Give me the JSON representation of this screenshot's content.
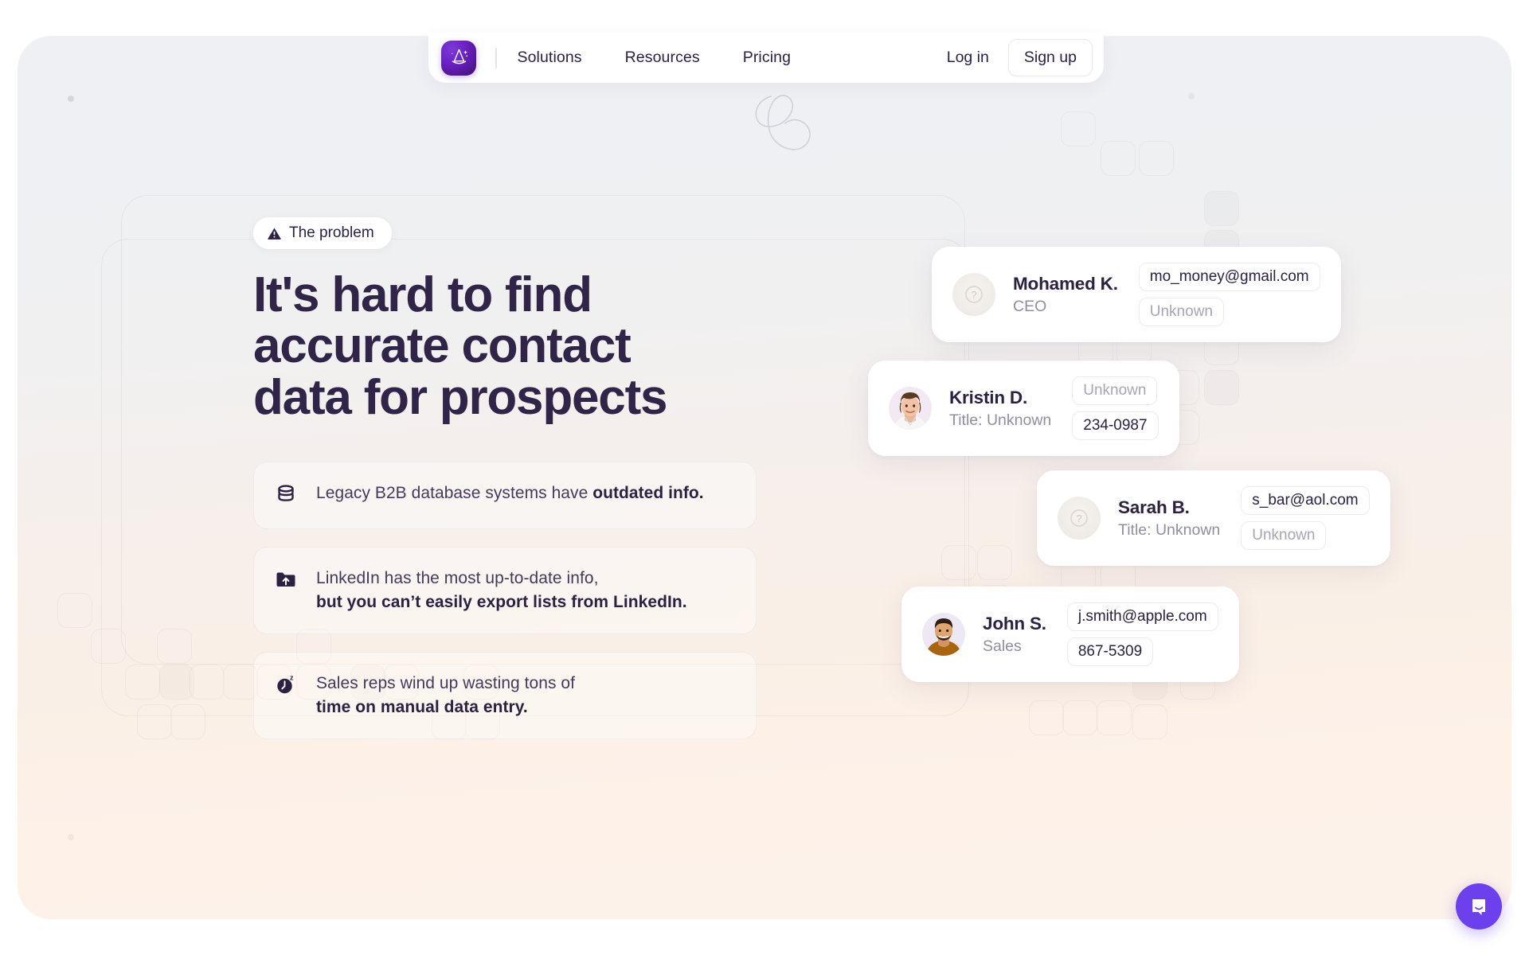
{
  "brand": {
    "logo_icon": "wizard-hat-icon",
    "logo_color": "#6b21c4"
  },
  "nav": {
    "links": [
      {
        "label": "Solutions"
      },
      {
        "label": "Resources"
      },
      {
        "label": "Pricing"
      }
    ],
    "login_label": "Log in",
    "signup_label": "Sign up"
  },
  "hero": {
    "badge": {
      "icon": "warning-triangle-icon",
      "label": "The problem"
    },
    "headline_line1": "It's hard to find",
    "headline_line2": "accurate contact",
    "headline_line3": "data for prospects"
  },
  "problems": [
    {
      "icon": "database-icon",
      "line1_plain": "Legacy B2B database systems have ",
      "line1_bold": "outdated info.",
      "line2_plain": "",
      "line2_bold": ""
    },
    {
      "icon": "folder-upload-icon",
      "line1_plain": "LinkedIn has the most up-to-date info,",
      "line1_bold": "",
      "line2_plain": "",
      "line2_bold": "but you can’t easily export lists from LinkedIn."
    },
    {
      "icon": "clock-sleep-icon",
      "line1_plain": "Sales reps wind up wasting tons of",
      "line1_bold": "",
      "line2_plain": "",
      "line2_bold": "time on manual data entry."
    }
  ],
  "contacts": [
    {
      "name": "Mohamed K.",
      "title": "CEO",
      "avatar": "unknown-avatar",
      "fields": [
        {
          "value": "mo_money@gmail.com",
          "unknown": false
        },
        {
          "value": "Unknown",
          "unknown": true
        }
      ]
    },
    {
      "name": "Kristin D.",
      "title": "Title: Unknown",
      "avatar": "photo-woman",
      "fields": [
        {
          "value": "Unknown",
          "unknown": true
        },
        {
          "value": "234-0987",
          "unknown": false
        }
      ]
    },
    {
      "name": "Sarah B.",
      "title": "Title: Unknown",
      "avatar": "unknown-avatar",
      "fields": [
        {
          "value": "s_bar@aol.com",
          "unknown": false
        },
        {
          "value": "Unknown",
          "unknown": true
        }
      ]
    },
    {
      "name": "John S.",
      "title": "Sales",
      "avatar": "photo-man",
      "fields": [
        {
          "value": "j.smith@apple.com",
          "unknown": false
        },
        {
          "value": "867-5309",
          "unknown": false
        }
      ]
    }
  ],
  "chat": {
    "icon": "chat-bubble-smile-icon",
    "color": "#6c40ec"
  },
  "colors": {
    "text_primary": "#2d2142",
    "text_muted": "#928da0",
    "bg_top": "#eef0f4",
    "bg_bottom": "#fdf2ea",
    "accent": "#6b21c4"
  }
}
